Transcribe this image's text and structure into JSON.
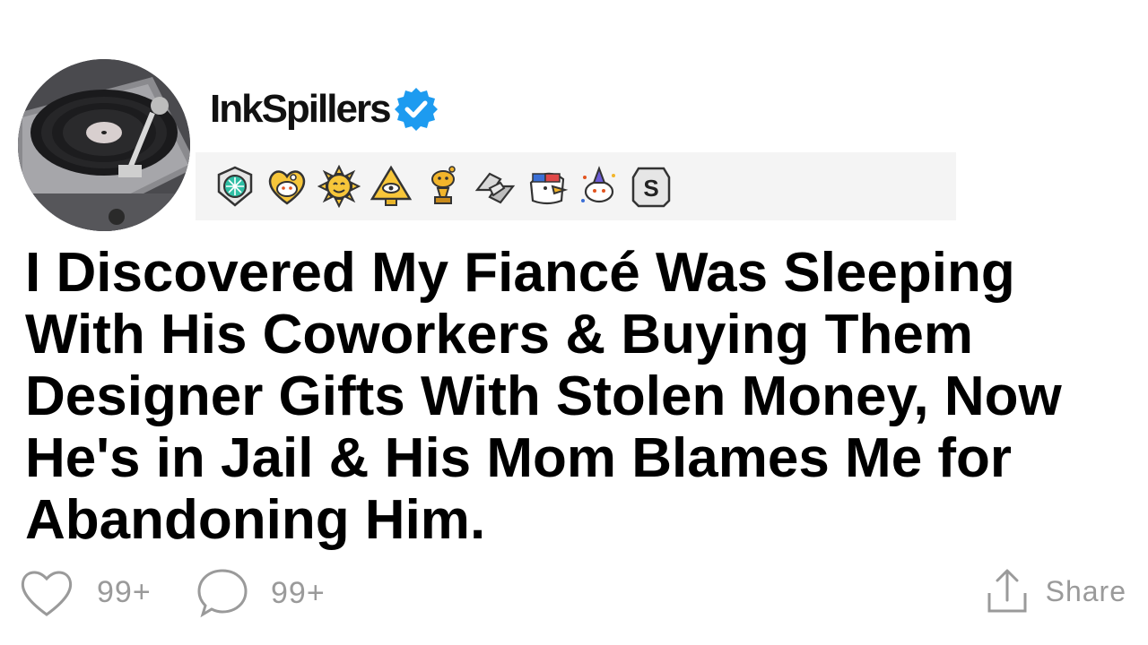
{
  "post": {
    "username": "InkSpillers",
    "verified": true,
    "title": "I Discovered My Fiancé Was Sleeping With His Coworkers & Buying Them Designer Gifts With Stolen Money, Now He's in Jail & His Mom Blames Me for Abandoning Him."
  },
  "avatar": {
    "icon": "record-player-image"
  },
  "awards": [
    {
      "icon": "gem-shield-award-icon"
    },
    {
      "icon": "wholesome-heart-award-icon"
    },
    {
      "icon": "sun-smile-award-icon"
    },
    {
      "icon": "pyramid-eye-award-icon"
    },
    {
      "icon": "gold-trophy-snoo-award-icon"
    },
    {
      "icon": "handshake-award-icon"
    },
    {
      "icon": "eagle-award-icon"
    },
    {
      "icon": "snoo-party-award-icon"
    },
    {
      "icon": "silver-s-award-icon"
    }
  ],
  "actions": {
    "likes": "99+",
    "comments": "99+",
    "share_label": "Share"
  },
  "colors": {
    "verified_blue": "#1d9bf0",
    "action_gray": "#9a9a9a",
    "award_strip": "#f4f4f4"
  }
}
